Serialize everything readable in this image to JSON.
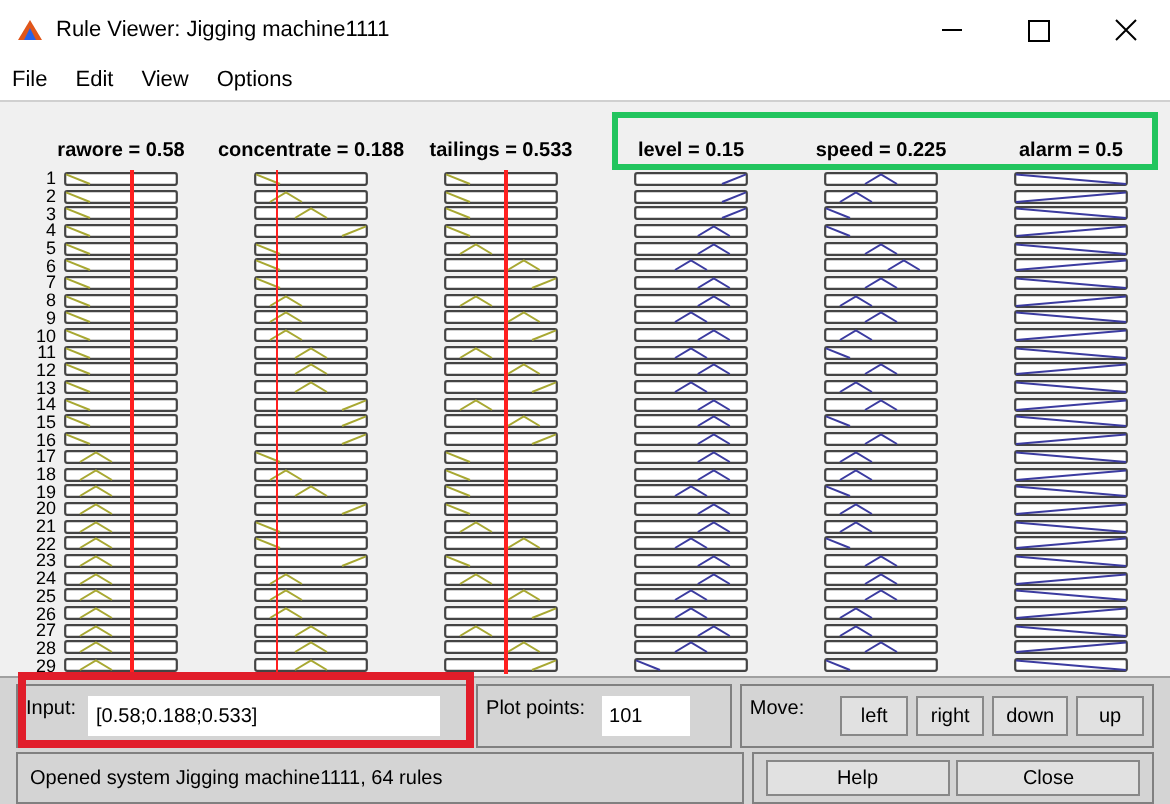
{
  "window": {
    "title": "Rule Viewer: Jigging machine1111"
  },
  "menu": [
    "File",
    "Edit",
    "View",
    "Options"
  ],
  "variables": [
    {
      "label": "rawore = 0.58",
      "kind": "input"
    },
    {
      "label": "concentrate = 0.188",
      "kind": "input"
    },
    {
      "label": "tailings = 0.533",
      "kind": "input"
    },
    {
      "label": "level = 0.15",
      "kind": "output"
    },
    {
      "label": "speed = 0.225",
      "kind": "output"
    },
    {
      "label": "alarm = 0.5",
      "kind": "output"
    }
  ],
  "rules": [
    {
      "number": "1",
      "mfs": [
        {
          "kind": "low"
        },
        {
          "kind": "low"
        },
        {
          "kind": "low"
        },
        {
          "kind": "high"
        },
        {
          "kind": "mid"
        },
        {
          "kind": "falling"
        }
      ]
    },
    {
      "number": "2",
      "mfs": [
        {
          "kind": "low"
        },
        {
          "kind": "mid_low"
        },
        {
          "kind": "low"
        },
        {
          "kind": "high"
        },
        {
          "kind": "mid_low"
        },
        {
          "kind": "rising"
        }
      ]
    },
    {
      "number": "3",
      "mfs": [
        {
          "kind": "low"
        },
        {
          "kind": "mid"
        },
        {
          "kind": "low"
        },
        {
          "kind": "high"
        },
        {
          "kind": "low"
        },
        {
          "kind": "falling"
        }
      ]
    },
    {
      "number": "4",
      "mfs": [
        {
          "kind": "low"
        },
        {
          "kind": "high"
        },
        {
          "kind": "low"
        },
        {
          "kind": "mid_high"
        },
        {
          "kind": "low"
        },
        {
          "kind": "rising"
        }
      ]
    },
    {
      "number": "5",
      "mfs": [
        {
          "kind": "low"
        },
        {
          "kind": "low"
        },
        {
          "kind": "mid_low"
        },
        {
          "kind": "mid_high"
        },
        {
          "kind": "mid"
        },
        {
          "kind": "falling"
        }
      ]
    },
    {
      "number": "6",
      "mfs": [
        {
          "kind": "low"
        },
        {
          "kind": "low"
        },
        {
          "kind": "mid_high"
        },
        {
          "kind": "mid"
        },
        {
          "kind": "mid_high"
        },
        {
          "kind": "rising"
        }
      ]
    },
    {
      "number": "7",
      "mfs": [
        {
          "kind": "low"
        },
        {
          "kind": "low"
        },
        {
          "kind": "high"
        },
        {
          "kind": "mid_high"
        },
        {
          "kind": "mid"
        },
        {
          "kind": "falling"
        }
      ]
    },
    {
      "number": "8",
      "mfs": [
        {
          "kind": "low"
        },
        {
          "kind": "mid_low"
        },
        {
          "kind": "mid_low"
        },
        {
          "kind": "mid_high"
        },
        {
          "kind": "mid_low"
        },
        {
          "kind": "rising"
        }
      ]
    },
    {
      "number": "9",
      "mfs": [
        {
          "kind": "low"
        },
        {
          "kind": "mid_low"
        },
        {
          "kind": "mid_high"
        },
        {
          "kind": "mid"
        },
        {
          "kind": "mid"
        },
        {
          "kind": "falling"
        }
      ]
    },
    {
      "number": "10",
      "mfs": [
        {
          "kind": "low"
        },
        {
          "kind": "mid_low"
        },
        {
          "kind": "high"
        },
        {
          "kind": "mid_high"
        },
        {
          "kind": "mid_low"
        },
        {
          "kind": "rising"
        }
      ]
    },
    {
      "number": "11",
      "mfs": [
        {
          "kind": "low"
        },
        {
          "kind": "mid"
        },
        {
          "kind": "mid_low"
        },
        {
          "kind": "mid"
        },
        {
          "kind": "low"
        },
        {
          "kind": "falling"
        }
      ]
    },
    {
      "number": "12",
      "mfs": [
        {
          "kind": "low"
        },
        {
          "kind": "mid"
        },
        {
          "kind": "mid_high"
        },
        {
          "kind": "mid_high"
        },
        {
          "kind": "mid"
        },
        {
          "kind": "rising"
        }
      ]
    },
    {
      "number": "13",
      "mfs": [
        {
          "kind": "low"
        },
        {
          "kind": "mid"
        },
        {
          "kind": "high"
        },
        {
          "kind": "mid"
        },
        {
          "kind": "mid_low"
        },
        {
          "kind": "falling"
        }
      ]
    },
    {
      "number": "14",
      "mfs": [
        {
          "kind": "low"
        },
        {
          "kind": "high"
        },
        {
          "kind": "mid_low"
        },
        {
          "kind": "mid_high"
        },
        {
          "kind": "mid"
        },
        {
          "kind": "rising"
        }
      ]
    },
    {
      "number": "15",
      "mfs": [
        {
          "kind": "low"
        },
        {
          "kind": "high"
        },
        {
          "kind": "mid_high"
        },
        {
          "kind": "mid_high"
        },
        {
          "kind": "low"
        },
        {
          "kind": "falling"
        }
      ]
    },
    {
      "number": "16",
      "mfs": [
        {
          "kind": "low"
        },
        {
          "kind": "high"
        },
        {
          "kind": "high"
        },
        {
          "kind": "mid_high"
        },
        {
          "kind": "mid"
        },
        {
          "kind": "rising"
        }
      ]
    },
    {
      "number": "17",
      "mfs": [
        {
          "kind": "mid_low"
        },
        {
          "kind": "low"
        },
        {
          "kind": "low"
        },
        {
          "kind": "mid_high"
        },
        {
          "kind": "mid_low"
        },
        {
          "kind": "falling"
        }
      ]
    },
    {
      "number": "18",
      "mfs": [
        {
          "kind": "mid_low"
        },
        {
          "kind": "mid_low"
        },
        {
          "kind": "low"
        },
        {
          "kind": "mid_high"
        },
        {
          "kind": "mid_low"
        },
        {
          "kind": "rising"
        }
      ]
    },
    {
      "number": "19",
      "mfs": [
        {
          "kind": "mid_low"
        },
        {
          "kind": "mid"
        },
        {
          "kind": "low"
        },
        {
          "kind": "mid"
        },
        {
          "kind": "low"
        },
        {
          "kind": "falling"
        }
      ]
    },
    {
      "number": "20",
      "mfs": [
        {
          "kind": "mid_low"
        },
        {
          "kind": "high"
        },
        {
          "kind": "low"
        },
        {
          "kind": "mid_high"
        },
        {
          "kind": "mid_low"
        },
        {
          "kind": "rising"
        }
      ]
    },
    {
      "number": "21",
      "mfs": [
        {
          "kind": "mid_low"
        },
        {
          "kind": "low"
        },
        {
          "kind": "mid_low"
        },
        {
          "kind": "mid_high"
        },
        {
          "kind": "mid_low"
        },
        {
          "kind": "falling"
        }
      ]
    },
    {
      "number": "22",
      "mfs": [
        {
          "kind": "mid_low"
        },
        {
          "kind": "low"
        },
        {
          "kind": "mid_high"
        },
        {
          "kind": "mid"
        },
        {
          "kind": "low"
        },
        {
          "kind": "rising"
        }
      ]
    },
    {
      "number": "23",
      "mfs": [
        {
          "kind": "mid_low"
        },
        {
          "kind": "high"
        },
        {
          "kind": "low"
        },
        {
          "kind": "mid_high"
        },
        {
          "kind": "mid"
        },
        {
          "kind": "falling"
        }
      ]
    },
    {
      "number": "24",
      "mfs": [
        {
          "kind": "mid_low"
        },
        {
          "kind": "mid_low"
        },
        {
          "kind": "mid_low"
        },
        {
          "kind": "mid_high"
        },
        {
          "kind": "mid"
        },
        {
          "kind": "rising"
        }
      ]
    },
    {
      "number": "25",
      "mfs": [
        {
          "kind": "mid_low"
        },
        {
          "kind": "mid_low"
        },
        {
          "kind": "mid_high"
        },
        {
          "kind": "mid"
        },
        {
          "kind": "mid"
        },
        {
          "kind": "falling"
        }
      ]
    },
    {
      "number": "26",
      "mfs": [
        {
          "kind": "mid_low"
        },
        {
          "kind": "mid_low"
        },
        {
          "kind": "high"
        },
        {
          "kind": "mid"
        },
        {
          "kind": "mid_low"
        },
        {
          "kind": "rising"
        }
      ]
    },
    {
      "number": "27",
      "mfs": [
        {
          "kind": "mid_low"
        },
        {
          "kind": "mid"
        },
        {
          "kind": "mid_low"
        },
        {
          "kind": "mid_high"
        },
        {
          "kind": "mid_low"
        },
        {
          "kind": "falling"
        }
      ]
    },
    {
      "number": "28",
      "mfs": [
        {
          "kind": "mid_low"
        },
        {
          "kind": "mid"
        },
        {
          "kind": "mid_high"
        },
        {
          "kind": "mid"
        },
        {
          "kind": "mid"
        },
        {
          "kind": "rising"
        }
      ]
    },
    {
      "number": "29",
      "mfs": [
        {
          "kind": "mid_low"
        },
        {
          "kind": "mid"
        },
        {
          "kind": "high"
        },
        {
          "kind": "low"
        },
        {
          "kind": "low"
        },
        {
          "kind": "falling"
        }
      ]
    }
  ],
  "highlights": [
    {
      "kind": "outputs",
      "color": "#22c55e"
    },
    {
      "kind": "input",
      "color": "#e11d2a"
    }
  ],
  "input": {
    "label": "Input:",
    "value": "[0.58;0.188;0.533]"
  },
  "plot_points": {
    "label": "Plot points:",
    "value": "101"
  },
  "move": {
    "label": "Move:",
    "buttons": [
      "left",
      "right",
      "down",
      "up"
    ]
  },
  "status": "Opened system Jigging machine1111, 64 rules",
  "buttons": [
    "Help",
    "Close"
  ]
}
